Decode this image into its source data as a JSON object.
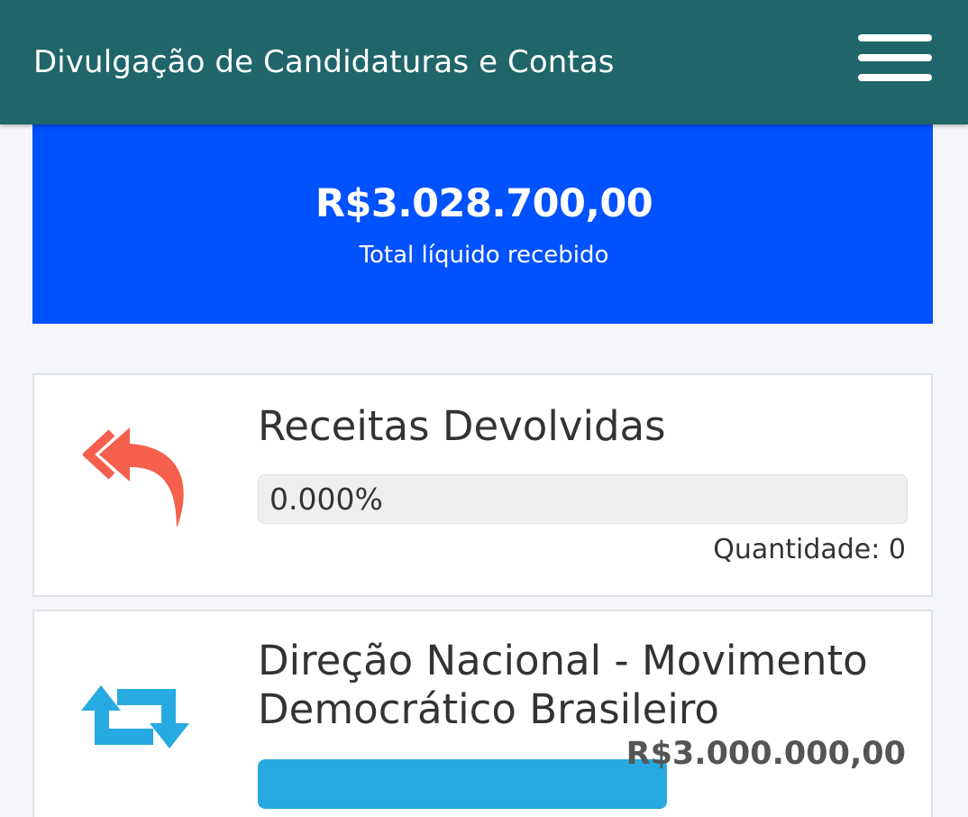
{
  "header": {
    "title": "Divulgação de Candidaturas e Contas",
    "menu_icon": "hamburger-menu-icon"
  },
  "summary": {
    "amount": "R$3.028.700,00",
    "label": "Total líquido recebido",
    "background_color": "#0051fe"
  },
  "cards": [
    {
      "title": "Receitas Devolvidas",
      "icon": "reply-all-icon",
      "icon_color": "#f4604c",
      "progress_text": "0.000%",
      "progress_fraction": 0,
      "quantity_text": "Quantidade: 0"
    },
    {
      "title": "Direção Nacional - Movimento Democrático Brasileiro",
      "icon": "transfer-arrows-icon",
      "icon_color": "#27a9e1",
      "amount": "R$3.000.000,00",
      "progress_fraction": 0.63,
      "progress_color": "#27a9e1"
    }
  ],
  "colors": {
    "header_bg": "#1f6569",
    "page_bg": "#f4f6f9"
  }
}
